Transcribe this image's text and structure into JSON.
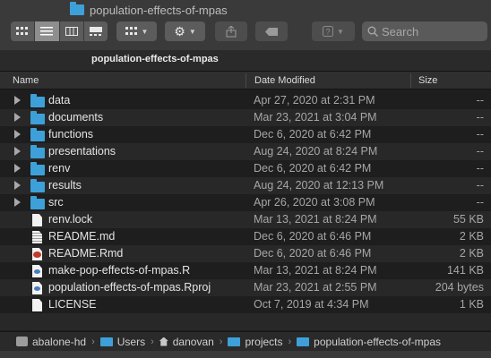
{
  "window": {
    "title": "population-effects-of-mpas"
  },
  "toolbar": {
    "view_icons": [
      "icon-view-icon",
      "list-view-icon",
      "column-view-icon",
      "gallery-view-icon"
    ],
    "search_placeholder": "Search"
  },
  "tab": {
    "title": "population-effects-of-mpas"
  },
  "columns": {
    "name": "Name",
    "date": "Date Modified",
    "size": "Size"
  },
  "files": [
    {
      "name": "data",
      "date": "Apr 27, 2020 at 2:31 PM",
      "size": "--",
      "kind": "folder"
    },
    {
      "name": "documents",
      "date": "Mar 23, 2021 at 3:04 PM",
      "size": "--",
      "kind": "folder"
    },
    {
      "name": "functions",
      "date": "Dec 6, 2020 at 6:42 PM",
      "size": "--",
      "kind": "folder"
    },
    {
      "name": "presentations",
      "date": "Aug 24, 2020 at 8:24 PM",
      "size": "--",
      "kind": "folder"
    },
    {
      "name": "renv",
      "date": "Dec 6, 2020 at 6:42 PM",
      "size": "--",
      "kind": "folder"
    },
    {
      "name": "results",
      "date": "Aug 24, 2020 at 12:13 PM",
      "size": "--",
      "kind": "folder"
    },
    {
      "name": "src",
      "date": "Apr 26, 2020 at 3:08 PM",
      "size": "--",
      "kind": "folder"
    },
    {
      "name": "renv.lock",
      "date": "Mar 13, 2021 at 8:24 PM",
      "size": "55 KB",
      "kind": "doc"
    },
    {
      "name": "README.md",
      "date": "Dec 6, 2020 at 6:46 PM",
      "size": "2 KB",
      "kind": "text"
    },
    {
      "name": "README.Rmd",
      "date": "Dec 6, 2020 at 6:46 PM",
      "size": "2 KB",
      "kind": "rmd"
    },
    {
      "name": "make-pop-effects-of-mpas.R",
      "date": "Mar 13, 2021 at 8:24 PM",
      "size": "141 KB",
      "kind": "r"
    },
    {
      "name": "population-effects-of-mpas.Rproj",
      "date": "Mar 23, 2021 at 2:55 PM",
      "size": "204 bytes",
      "kind": "r"
    },
    {
      "name": "LICENSE",
      "date": "Oct 7, 2019 at 4:34 PM",
      "size": "1 KB",
      "kind": "doc"
    }
  ],
  "pathbar": {
    "disk": "abalone-hd",
    "users": "Users",
    "home": "danovan",
    "projects": "projects",
    "current": "population-effects-of-mpas"
  },
  "colors": {
    "folder": "#3ea0d8",
    "background": "#1e1e1e",
    "toolbar": "#3a3a3a"
  }
}
